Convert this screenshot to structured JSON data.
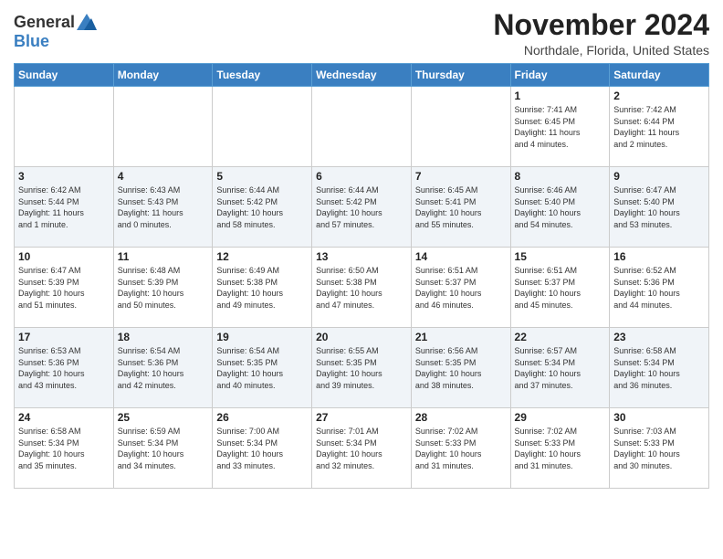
{
  "header": {
    "logo_general": "General",
    "logo_blue": "Blue",
    "month": "November 2024",
    "location": "Northdale, Florida, United States"
  },
  "weekdays": [
    "Sunday",
    "Monday",
    "Tuesday",
    "Wednesday",
    "Thursday",
    "Friday",
    "Saturday"
  ],
  "weeks": [
    [
      {
        "day": "",
        "info": ""
      },
      {
        "day": "",
        "info": ""
      },
      {
        "day": "",
        "info": ""
      },
      {
        "day": "",
        "info": ""
      },
      {
        "day": "",
        "info": ""
      },
      {
        "day": "1",
        "info": "Sunrise: 7:41 AM\nSunset: 6:45 PM\nDaylight: 11 hours\nand 4 minutes."
      },
      {
        "day": "2",
        "info": "Sunrise: 7:42 AM\nSunset: 6:44 PM\nDaylight: 11 hours\nand 2 minutes."
      }
    ],
    [
      {
        "day": "3",
        "info": "Sunrise: 6:42 AM\nSunset: 5:44 PM\nDaylight: 11 hours\nand 1 minute."
      },
      {
        "day": "4",
        "info": "Sunrise: 6:43 AM\nSunset: 5:43 PM\nDaylight: 11 hours\nand 0 minutes."
      },
      {
        "day": "5",
        "info": "Sunrise: 6:44 AM\nSunset: 5:42 PM\nDaylight: 10 hours\nand 58 minutes."
      },
      {
        "day": "6",
        "info": "Sunrise: 6:44 AM\nSunset: 5:42 PM\nDaylight: 10 hours\nand 57 minutes."
      },
      {
        "day": "7",
        "info": "Sunrise: 6:45 AM\nSunset: 5:41 PM\nDaylight: 10 hours\nand 55 minutes."
      },
      {
        "day": "8",
        "info": "Sunrise: 6:46 AM\nSunset: 5:40 PM\nDaylight: 10 hours\nand 54 minutes."
      },
      {
        "day": "9",
        "info": "Sunrise: 6:47 AM\nSunset: 5:40 PM\nDaylight: 10 hours\nand 53 minutes."
      }
    ],
    [
      {
        "day": "10",
        "info": "Sunrise: 6:47 AM\nSunset: 5:39 PM\nDaylight: 10 hours\nand 51 minutes."
      },
      {
        "day": "11",
        "info": "Sunrise: 6:48 AM\nSunset: 5:39 PM\nDaylight: 10 hours\nand 50 minutes."
      },
      {
        "day": "12",
        "info": "Sunrise: 6:49 AM\nSunset: 5:38 PM\nDaylight: 10 hours\nand 49 minutes."
      },
      {
        "day": "13",
        "info": "Sunrise: 6:50 AM\nSunset: 5:38 PM\nDaylight: 10 hours\nand 47 minutes."
      },
      {
        "day": "14",
        "info": "Sunrise: 6:51 AM\nSunset: 5:37 PM\nDaylight: 10 hours\nand 46 minutes."
      },
      {
        "day": "15",
        "info": "Sunrise: 6:51 AM\nSunset: 5:37 PM\nDaylight: 10 hours\nand 45 minutes."
      },
      {
        "day": "16",
        "info": "Sunrise: 6:52 AM\nSunset: 5:36 PM\nDaylight: 10 hours\nand 44 minutes."
      }
    ],
    [
      {
        "day": "17",
        "info": "Sunrise: 6:53 AM\nSunset: 5:36 PM\nDaylight: 10 hours\nand 43 minutes."
      },
      {
        "day": "18",
        "info": "Sunrise: 6:54 AM\nSunset: 5:36 PM\nDaylight: 10 hours\nand 42 minutes."
      },
      {
        "day": "19",
        "info": "Sunrise: 6:54 AM\nSunset: 5:35 PM\nDaylight: 10 hours\nand 40 minutes."
      },
      {
        "day": "20",
        "info": "Sunrise: 6:55 AM\nSunset: 5:35 PM\nDaylight: 10 hours\nand 39 minutes."
      },
      {
        "day": "21",
        "info": "Sunrise: 6:56 AM\nSunset: 5:35 PM\nDaylight: 10 hours\nand 38 minutes."
      },
      {
        "day": "22",
        "info": "Sunrise: 6:57 AM\nSunset: 5:34 PM\nDaylight: 10 hours\nand 37 minutes."
      },
      {
        "day": "23",
        "info": "Sunrise: 6:58 AM\nSunset: 5:34 PM\nDaylight: 10 hours\nand 36 minutes."
      }
    ],
    [
      {
        "day": "24",
        "info": "Sunrise: 6:58 AM\nSunset: 5:34 PM\nDaylight: 10 hours\nand 35 minutes."
      },
      {
        "day": "25",
        "info": "Sunrise: 6:59 AM\nSunset: 5:34 PM\nDaylight: 10 hours\nand 34 minutes."
      },
      {
        "day": "26",
        "info": "Sunrise: 7:00 AM\nSunset: 5:34 PM\nDaylight: 10 hours\nand 33 minutes."
      },
      {
        "day": "27",
        "info": "Sunrise: 7:01 AM\nSunset: 5:34 PM\nDaylight: 10 hours\nand 32 minutes."
      },
      {
        "day": "28",
        "info": "Sunrise: 7:02 AM\nSunset: 5:33 PM\nDaylight: 10 hours\nand 31 minutes."
      },
      {
        "day": "29",
        "info": "Sunrise: 7:02 AM\nSunset: 5:33 PM\nDaylight: 10 hours\nand 31 minutes."
      },
      {
        "day": "30",
        "info": "Sunrise: 7:03 AM\nSunset: 5:33 PM\nDaylight: 10 hours\nand 30 minutes."
      }
    ]
  ]
}
